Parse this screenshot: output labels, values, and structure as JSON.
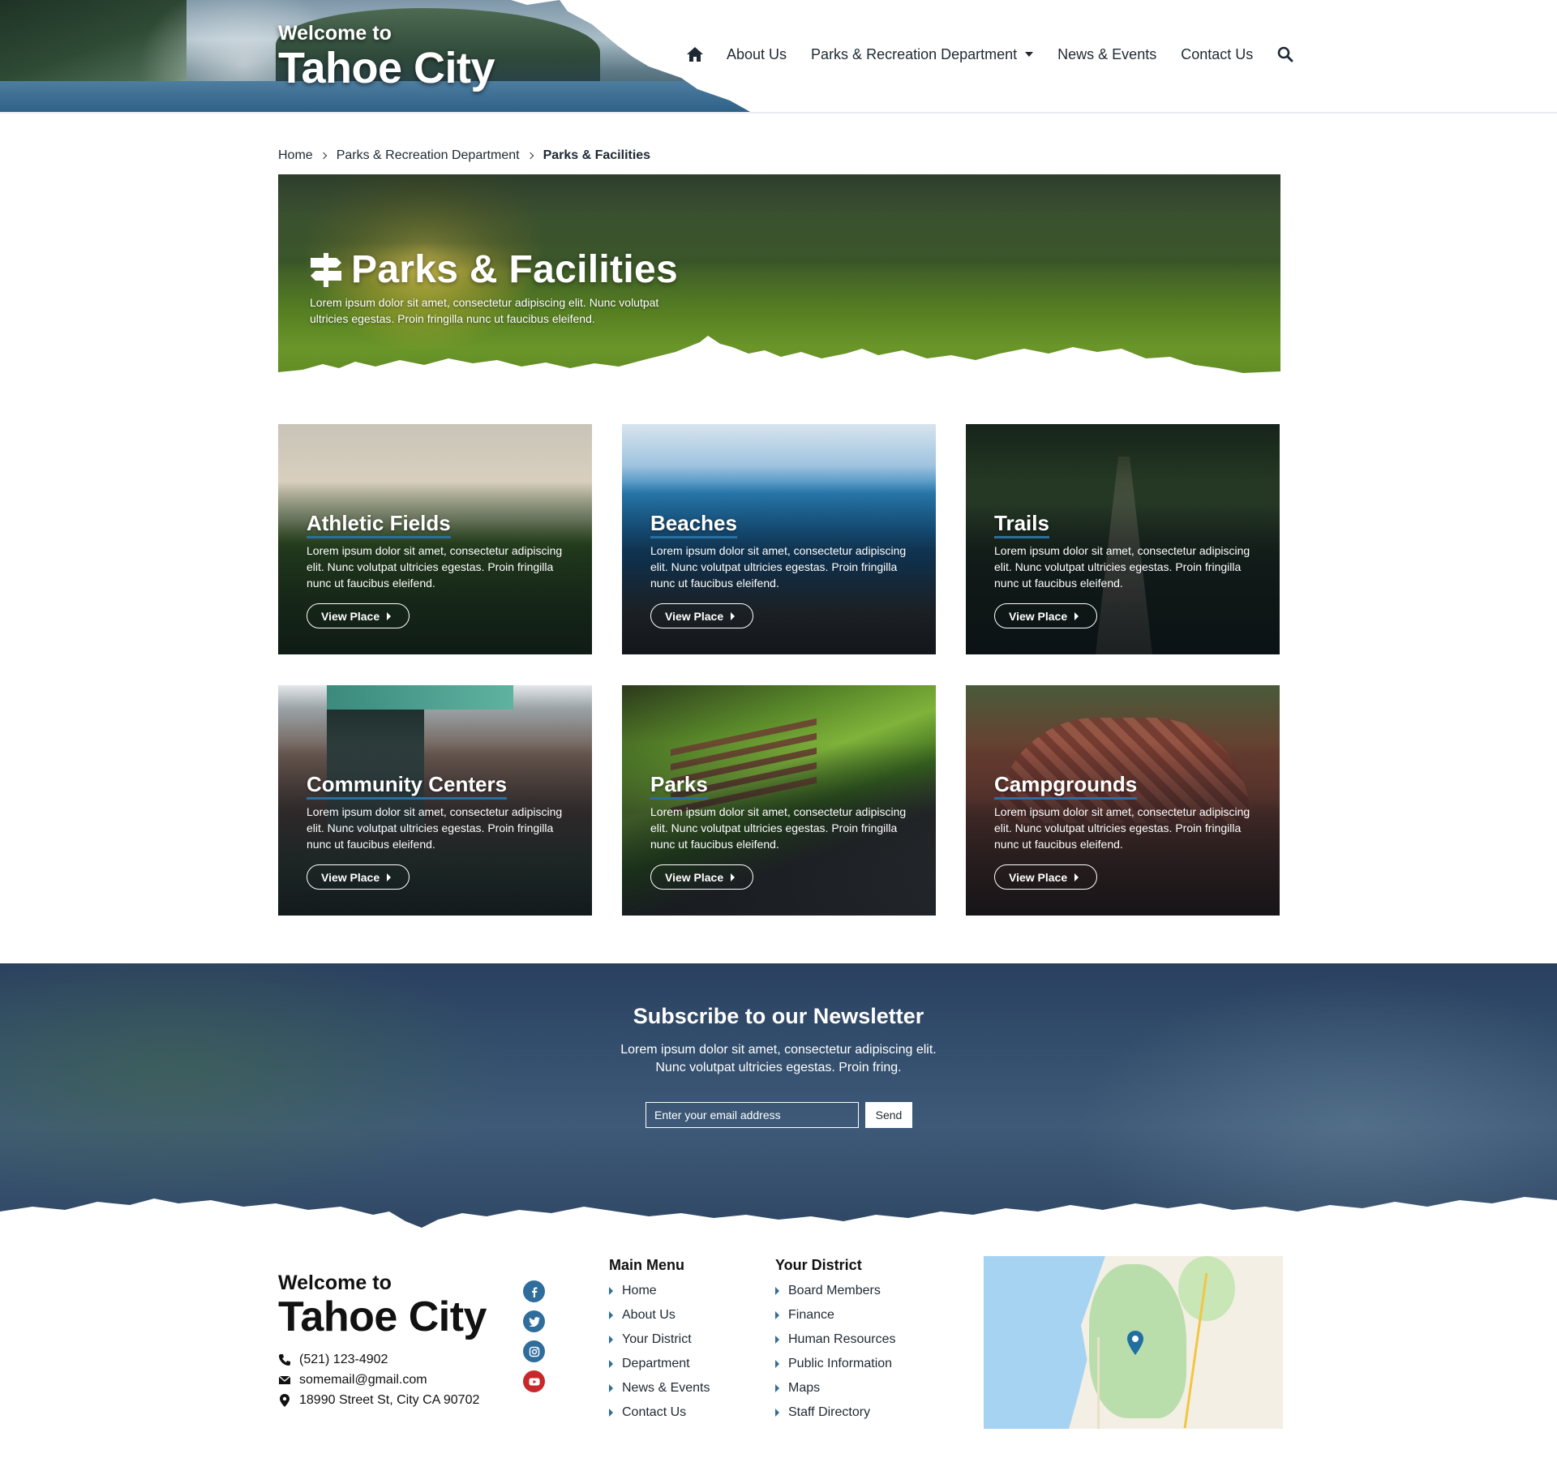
{
  "header": {
    "logo_line1": "Welcome to",
    "logo_line2": "Tahoe City",
    "nav": {
      "home_icon": "home-icon",
      "items": [
        "About Us",
        "Parks & Recreation Department",
        "News & Events",
        "Contact Us"
      ],
      "search_icon": "search-icon"
    }
  },
  "breadcrumb": {
    "items": [
      "Home",
      "Parks & Recreation Department"
    ],
    "current": "Parks & Facilities"
  },
  "hero": {
    "icon": "signpost-icon",
    "title": "Parks & Facilities",
    "description": "Lorem ipsum dolor sit amet, consectetur adipiscing elit. Nunc volutpat ultricies egestas. Proin fringilla nunc ut faucibus eleifend."
  },
  "cards": [
    {
      "title": "Athletic Fields",
      "description": "Lorem ipsum dolor sit amet, consectetur adipiscing elit. Nunc volutpat ultricies egestas. Proin fringilla nunc ut faucibus eleifend.",
      "button": "View Place"
    },
    {
      "title": "Beaches",
      "description": "Lorem ipsum dolor sit amet, consectetur adipiscing elit. Nunc volutpat ultricies egestas. Proin fringilla nunc ut faucibus eleifend.",
      "button": "View Place"
    },
    {
      "title": "Trails",
      "description": "Lorem ipsum dolor sit amet, consectetur adipiscing elit. Nunc volutpat ultricies egestas. Proin fringilla nunc ut faucibus eleifend.",
      "button": "View Place"
    },
    {
      "title": "Community Centers",
      "description": "Lorem ipsum dolor sit amet, consectetur adipiscing elit. Nunc volutpat ultricies egestas. Proin fringilla nunc ut faucibus eleifend.",
      "button": "View Place"
    },
    {
      "title": "Parks",
      "description": "Lorem ipsum dolor sit amet, consectetur adipiscing elit. Nunc volutpat ultricies egestas. Proin fringilla nunc ut faucibus eleifend.",
      "button": "View Place"
    },
    {
      "title": "Campgrounds",
      "description": "Lorem ipsum dolor sit amet, consectetur adipiscing elit. Nunc volutpat ultricies egestas. Proin fringilla nunc ut faucibus eleifend.",
      "button": "View Place"
    }
  ],
  "newsletter": {
    "title": "Subscribe to our Newsletter",
    "line1": "Lorem ipsum dolor sit amet, consectetur adipiscing elit.",
    "line2": "Nunc volutpat ultricies egestas. Proin fring.",
    "email_placeholder": "Enter your email address",
    "send_label": "Send"
  },
  "footer": {
    "logo_line1": "Welcome to",
    "logo_line2": "Tahoe City",
    "phone": "(521) 123-4902",
    "email": "somemail@gmail.com",
    "address": "18990 Street St, City CA 90702",
    "social": [
      "facebook-icon",
      "twitter-icon",
      "instagram-icon",
      "youtube-icon"
    ],
    "main_menu": {
      "title": "Main Menu",
      "items": [
        "Home",
        "About Us",
        "Your District",
        "Department",
        "News & Events",
        "Contact Us"
      ]
    },
    "your_district": {
      "title": "Your District",
      "items": [
        "Board Members",
        "Finance",
        "Human Resources",
        "Public Information",
        "Maps",
        "Staff Directory"
      ]
    }
  },
  "colors": {
    "accent": "#2f6d9c",
    "newsletter_bg": "#34506e",
    "youtube": "#c8282b"
  }
}
